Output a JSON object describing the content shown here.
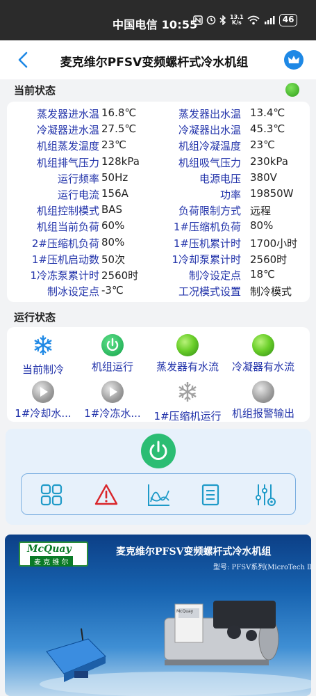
{
  "status_bar": {
    "carrier_time": "中国电信 10:55",
    "net_speed_top": "13.1",
    "net_speed_bottom": "K/s",
    "battery": "46",
    "icons": [
      "nfc-icon",
      "alarm-icon",
      "bluetooth-icon",
      "wifi-icon",
      "signal-4g-icon"
    ]
  },
  "header": {
    "title": "麦克维尔PFSV变频螺杆式冷水机组",
    "back_icon": "chevron-left-icon",
    "vip_icon": "crown-icon"
  },
  "current_status": {
    "title": "当前状态",
    "indicator_color": "#3fb52a",
    "rows": [
      {
        "l1": "蒸发器进水温",
        "v1": "16.8℃",
        "l2": "蒸发器出水温",
        "v2": "13.4℃"
      },
      {
        "l1": "冷凝器进水温",
        "v1": "27.5℃",
        "l2": "冷凝器出水温",
        "v2": "45.3℃"
      },
      {
        "l1": "机组蒸发温度",
        "v1": "23℃",
        "l2": "机组冷凝温度",
        "v2": "23℃"
      },
      {
        "l1": "机组排气压力",
        "v1": "128kPa",
        "l2": "机组吸气压力",
        "v2": "230kPa"
      },
      {
        "l1": "运行频率",
        "v1": "50Hz",
        "l2": "电源电压",
        "v2": "380V"
      },
      {
        "l1": "运行电流",
        "v1": "156A",
        "l2": "功率",
        "v2": "19850W"
      },
      {
        "l1": "机组控制模式",
        "v1": "BAS",
        "l2": "负荷限制方式",
        "v2": "远程"
      },
      {
        "l1": "机组当前负荷",
        "v1": "60%",
        "l2": "1#压缩机负荷",
        "v2": "80%"
      },
      {
        "l1": "2#压缩机负荷",
        "v1": "80%",
        "l2": "1#压机累计时",
        "v2": "1700小时"
      },
      {
        "l1": "1#压机启动数",
        "v1": "50次",
        "l2": "1冷却泵累计时",
        "v2": "2560时"
      },
      {
        "l1": "1冷冻泵累计时",
        "v1": "2560时",
        "l2": "制冷设定点",
        "v2": "18℃"
      },
      {
        "l1": "制冰设定点",
        "v1": "-3℃",
        "l2": "工况模式设置",
        "v2": "制冷模式"
      }
    ]
  },
  "run_status": {
    "title": "运行状态",
    "items": [
      {
        "label": "当前制冷",
        "icon": "snowflake-blue-icon"
      },
      {
        "label": "机组运行",
        "icon": "power-green-icon"
      },
      {
        "label": "蒸发器有水流",
        "icon": "green-ball-icon"
      },
      {
        "label": "冷凝器有水流",
        "icon": "green-ball-icon"
      },
      {
        "label": "1#冷却水...",
        "icon": "play-gray-icon"
      },
      {
        "label": "1#冷冻水...",
        "icon": "play-gray-icon"
      },
      {
        "label": "1#压缩机运行",
        "icon": "snowflake-gray-icon"
      },
      {
        "label": "机组报警输出",
        "icon": "gray-ball-icon"
      }
    ]
  },
  "controls": {
    "power_icon": "power-icon",
    "tools": [
      "grid-icon",
      "warning-icon",
      "chart-icon",
      "document-icon",
      "sliders-icon"
    ]
  },
  "banner": {
    "logo_en": "McQuay",
    "logo_cn": "麦 克 维 尔",
    "title": "麦克维尔PFSV变频螺杆式冷水机组",
    "subtitle": "型号: PFSV系列(MicroTech Ⅲ)"
  }
}
